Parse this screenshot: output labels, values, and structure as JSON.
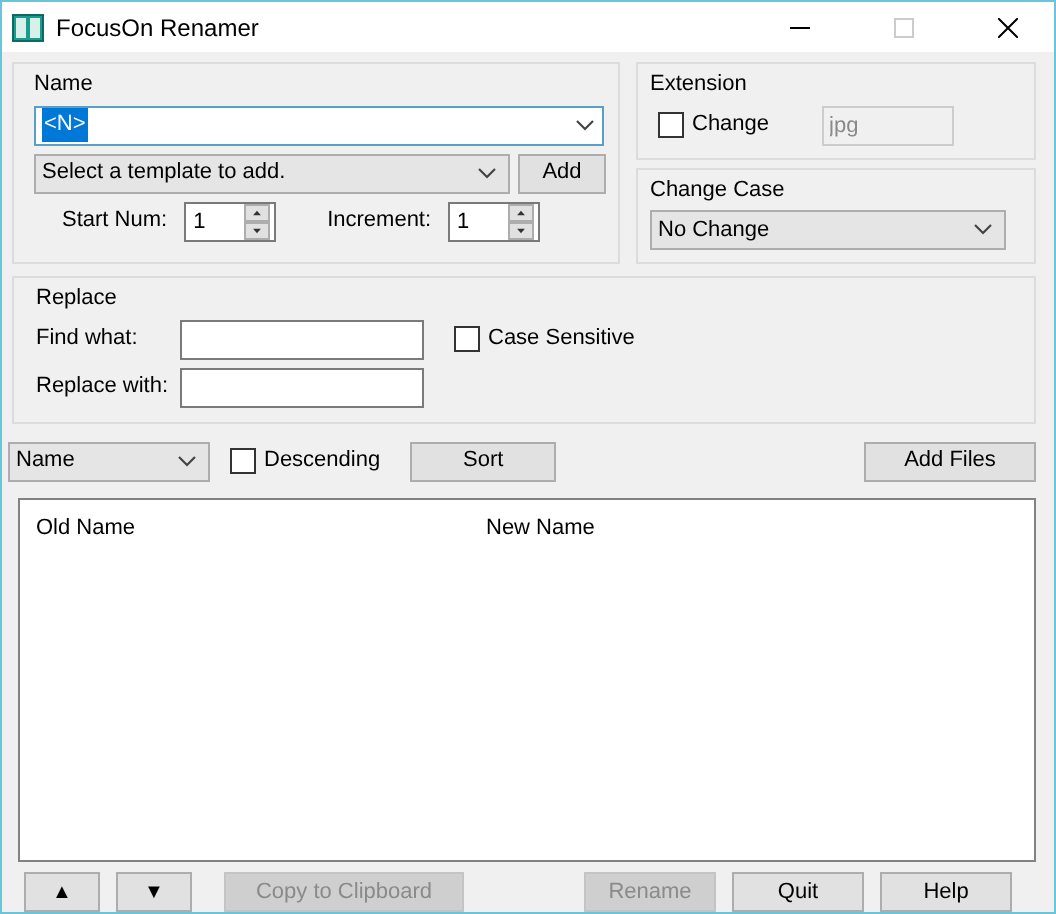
{
  "window": {
    "title": "FocusOn Renamer"
  },
  "name_group": {
    "title": "Name",
    "pattern": "<N>",
    "template": "Select a template to add.",
    "add_button": "Add",
    "start_num": {
      "label": "Start Num:",
      "value": "1"
    },
    "increment": {
      "label": "Increment:",
      "value": "1"
    }
  },
  "extension": {
    "title": "Extension",
    "change": {
      "label": "Change",
      "checked": false
    },
    "value": "jpg",
    "disabled": true
  },
  "change_case": {
    "title": "Change Case",
    "value": "No Change"
  },
  "replace": {
    "title": "Replace",
    "find_label": "Find what:",
    "replace_label": "Replace with:",
    "case_sensitive": {
      "label": "Case Sensitive",
      "checked": false
    }
  },
  "sort": {
    "field": "Name",
    "descending": {
      "label": "Descending",
      "checked": false
    },
    "sort_button": "Sort",
    "add_files_button": "Add Files"
  },
  "file_list": {
    "columns": [
      "Old Name",
      "New Name"
    ]
  },
  "buttons": [
    {
      "label": "▲",
      "kind": "small",
      "disabled": false
    },
    {
      "label": "▼",
      "kind": "small",
      "disabled": false
    },
    {
      "label": "Copy to Clipboard",
      "kind": "wide",
      "disabled": true
    },
    {
      "label": "Rename",
      "kind": "medium",
      "disabled": true
    },
    {
      "label": "Quit",
      "kind": "medium",
      "disabled": false
    },
    {
      "label": "Help",
      "kind": "medium",
      "disabled": false
    }
  ]
}
